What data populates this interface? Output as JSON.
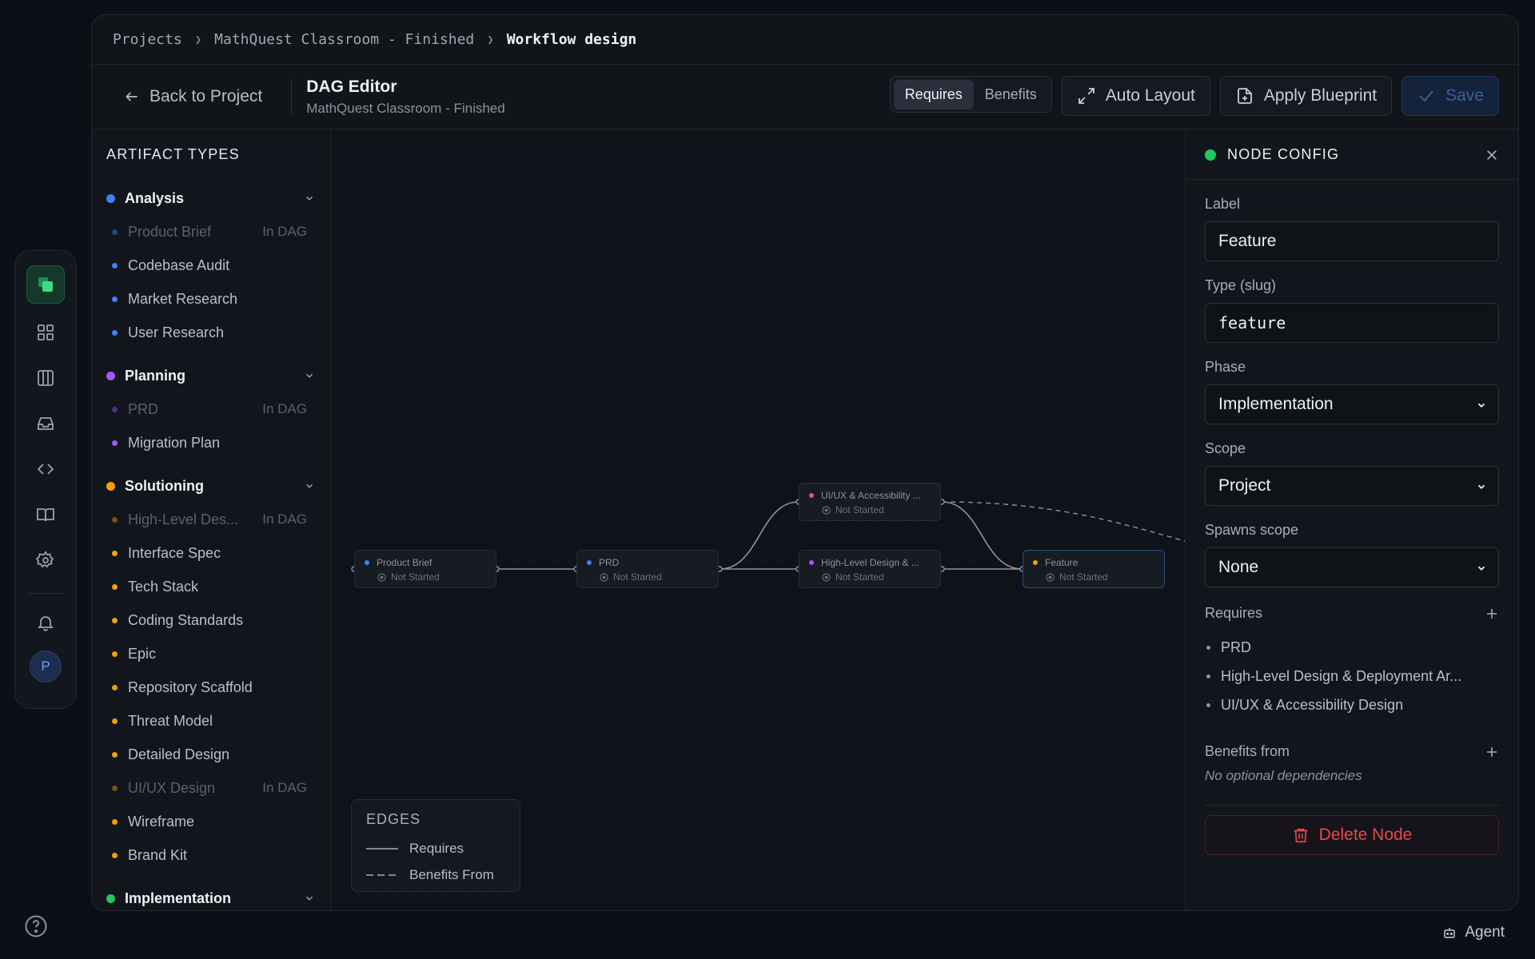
{
  "breadcrumbs": [
    "Projects",
    "MathQuest Classroom - Finished",
    "Workflow design"
  ],
  "toolbar": {
    "back_label": "Back to Project",
    "title": "DAG Editor",
    "subtitle": "MathQuest Classroom - Finished",
    "seg_requires": "Requires",
    "seg_benefits": "Benefits",
    "seg_active": "Requires",
    "auto_layout": "Auto Layout",
    "apply_blueprint": "Apply Blueprint",
    "save": "Save"
  },
  "sidebar": {
    "title": "ARTIFACT TYPES",
    "groups": [
      {
        "name": "Analysis",
        "color": "#3b82f6",
        "items": [
          {
            "label": "Product Brief",
            "tag": "In DAG"
          },
          {
            "label": "Codebase Audit"
          },
          {
            "label": "Market Research"
          },
          {
            "label": "User Research"
          }
        ]
      },
      {
        "name": "Planning",
        "color": "#a855f7",
        "items": [
          {
            "label": "PRD",
            "tag": "In DAG"
          },
          {
            "label": "Migration Plan"
          }
        ]
      },
      {
        "name": "Solutioning",
        "color": "#f59e0b",
        "items": [
          {
            "label": "High-Level Des...",
            "tag": "In DAG"
          },
          {
            "label": "Interface Spec"
          },
          {
            "label": "Tech Stack"
          },
          {
            "label": "Coding Standards"
          },
          {
            "label": "Epic"
          },
          {
            "label": "Repository Scaffold"
          },
          {
            "label": "Threat Model"
          },
          {
            "label": "Detailed Design"
          },
          {
            "label": "UI/UX Design",
            "tag": "In DAG"
          },
          {
            "label": "Wireframe"
          },
          {
            "label": "Brand Kit"
          }
        ]
      },
      {
        "name": "Implementation",
        "color": "#22c55e",
        "items": []
      }
    ]
  },
  "canvas": {
    "status": "Not Started",
    "nodes": [
      {
        "id": "product-brief",
        "label": "Product Brief",
        "color": "#3b82f6"
      },
      {
        "id": "prd",
        "label": "PRD",
        "color": "#3b82f6"
      },
      {
        "id": "uiux",
        "label": "UI/UX & Accessibility ...",
        "color": "#ec4899"
      },
      {
        "id": "hld",
        "label": "High-Level Design & ...",
        "color": "#a855f7"
      },
      {
        "id": "feature",
        "label": "Feature",
        "color": "#f59e0b"
      }
    ],
    "legend": {
      "title": "EDGES",
      "requires": "Requires",
      "benefits": "Benefits From"
    }
  },
  "panel": {
    "title": "NODE CONFIG",
    "label_label": "Label",
    "label_value": "Feature",
    "type_label": "Type (slug)",
    "type_value": "feature",
    "phase_label": "Phase",
    "phase_value": "Implementation",
    "scope_label": "Scope",
    "scope_value": "Project",
    "spawns_label": "Spawns scope",
    "spawns_value": "None",
    "requires_label": "Requires",
    "requires": [
      "PRD",
      "High-Level Design & Deployment Ar...",
      "UI/UX & Accessibility Design"
    ],
    "benefits_label": "Benefits from",
    "benefits_empty": "No optional dependencies",
    "delete_label": "Delete Node"
  },
  "footer": {
    "agent_label": "Agent"
  }
}
